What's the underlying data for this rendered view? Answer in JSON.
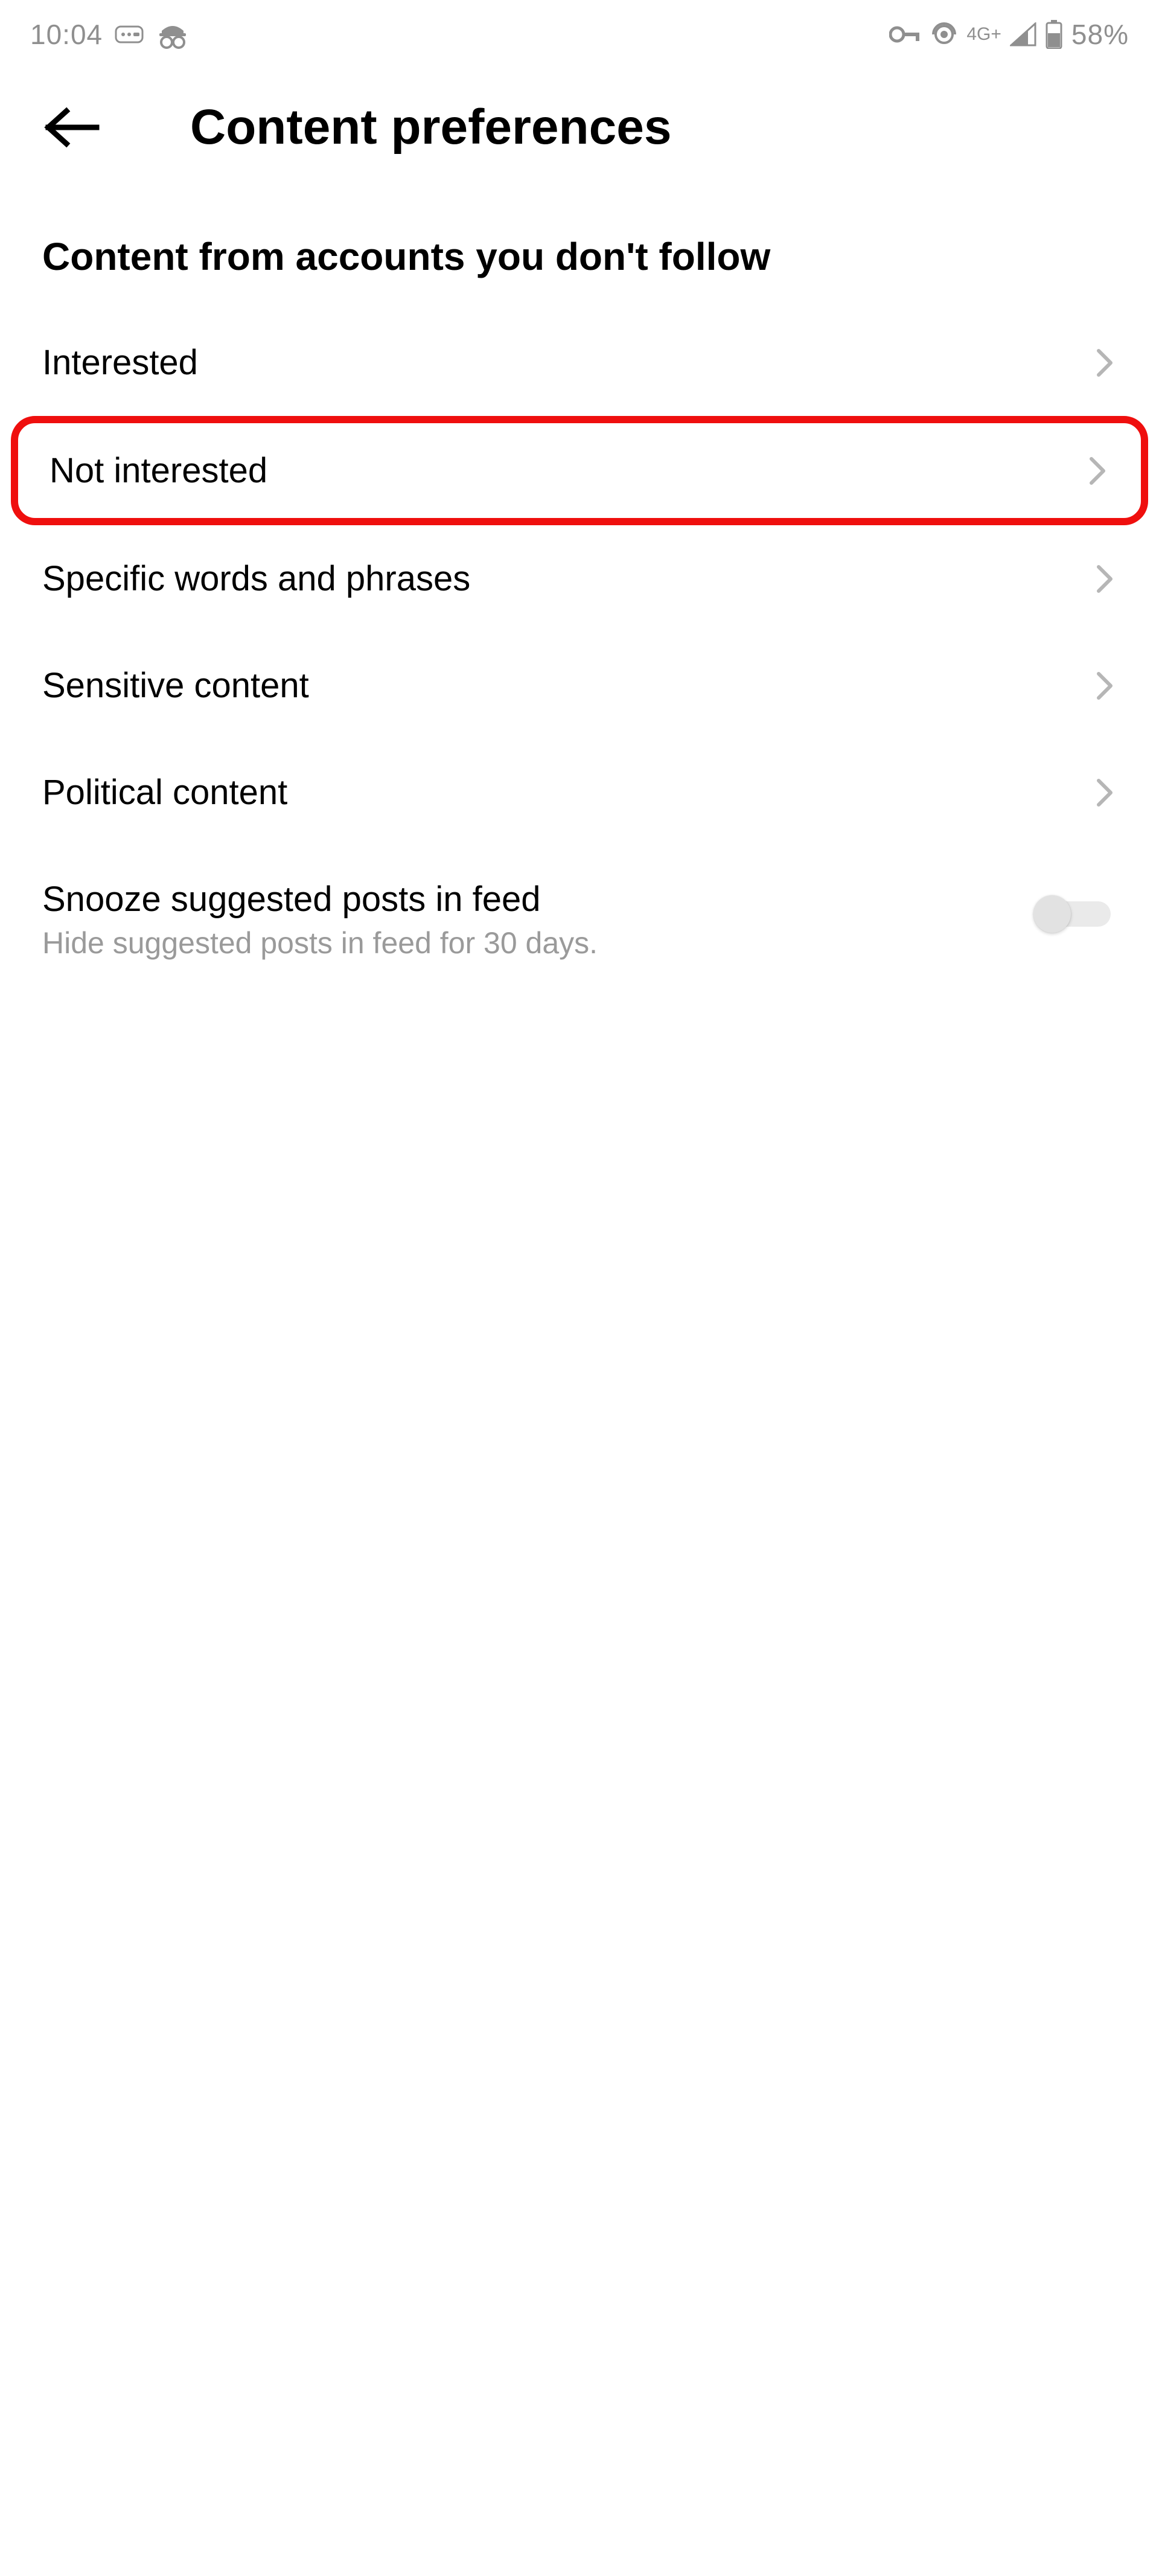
{
  "status": {
    "time": "10:04",
    "network": "4G+",
    "battery": "58%"
  },
  "header": {
    "title": "Content preferences"
  },
  "section": {
    "heading": "Content from accounts you don't follow"
  },
  "items": [
    {
      "label": "Interested"
    },
    {
      "label": "Not interested"
    },
    {
      "label": "Specific words and phrases"
    },
    {
      "label": "Sensitive content"
    },
    {
      "label": "Political content"
    }
  ],
  "snooze": {
    "label": "Snooze suggested posts in feed",
    "sublabel": "Hide suggested posts in feed for 30 days."
  }
}
